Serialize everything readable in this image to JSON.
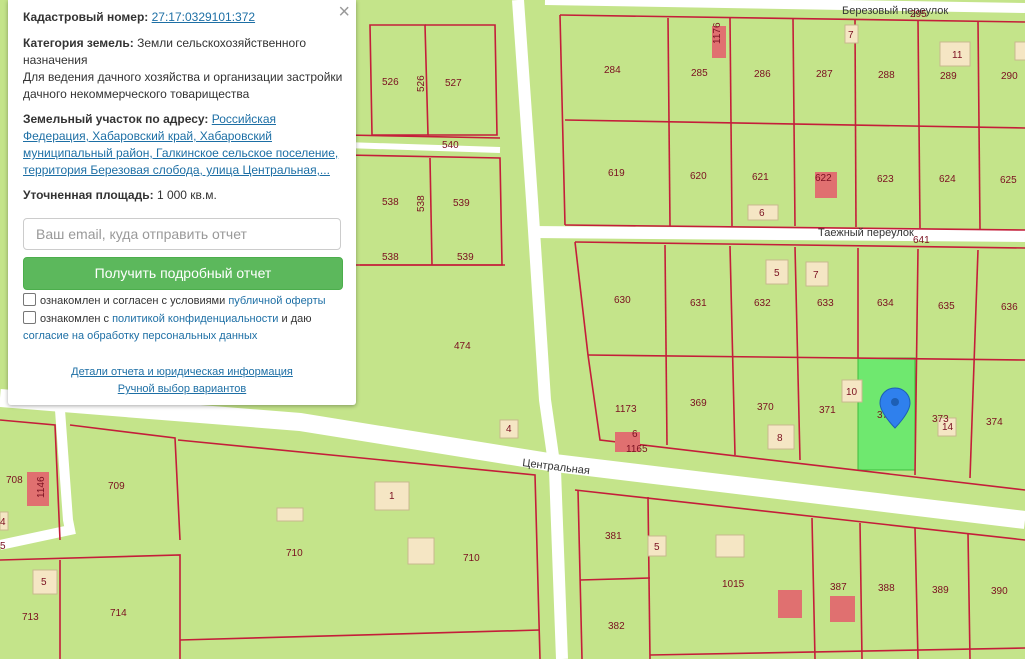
{
  "panel": {
    "close_label": "×",
    "cadastral_label": "Кадастровый номер:",
    "cadastral_value": "27:17:0329101:372",
    "category_label": "Категория земель:",
    "category_value": "Земли сельскохозяйственного",
    "category_value_2": "назначения",
    "usage_line1": "Для ведения дачного хозяйства и организации застройки",
    "usage_line2": "дачного некоммерческого товарищества",
    "address_label": "Земельный участок по адресу:",
    "address_l1": "Российская",
    "address_l2": "Федерация, Хабаровский край, Хабаровский",
    "address_l3": "муниципальный район, Галкинское сельское поселение,",
    "address_l4": "территория Березовая слобода, улица Центральная,...",
    "area_label": "Уточненная площадь:",
    "area_value": "1 000 кв.м.",
    "email_placeholder": "Ваш email, куда отправить отчет",
    "submit_label": "Получить подробный отчет",
    "consent1_text": "ознакомлен и согласен с условиями",
    "consent1_link": "публичной оферты",
    "consent2_text": "ознакомлен с",
    "consent2_link": "политикой конфиденциальности",
    "consent2_text2": "и даю",
    "consent2_link2": "согласие на обработку персональных данных",
    "details_link": "Детали отчета и юридическая информация",
    "manual_link": "Ручной выбор вариантов"
  },
  "map": {
    "colors": {
      "land": "#c4e48a",
      "boundary": "#c41e3a",
      "road": "#ffffff",
      "selected": "#6fe86f",
      "marker": "#2f80ed",
      "house": "#f5e6c4",
      "building": "#e07070"
    },
    "street_labels": {
      "berezovy": "Березовый переулок",
      "taezhny": "Таежный переулок",
      "centralnaya": "Центральная"
    },
    "parcel_labels": [
      "295",
      "1176",
      "284",
      "285",
      "286",
      "287",
      "288",
      "289",
      "290",
      "7",
      "11",
      "526",
      "526",
      "527",
      "540",
      "619",
      "620",
      "621",
      "622",
      "623",
      "624",
      "625",
      "6",
      "538",
      "538",
      "539",
      "538",
      "539",
      "641",
      "5",
      "7",
      "630",
      "631",
      "632",
      "633",
      "634",
      "635",
      "636",
      "474",
      "1173",
      "369",
      "370",
      "371",
      "10",
      "372",
      "373",
      "374",
      "14",
      "4",
      "8",
      "6",
      "1165",
      "708",
      "1146",
      "709",
      "1",
      "710",
      "710",
      "4",
      "5",
      "381",
      "5",
      "1015",
      "387",
      "388",
      "389",
      "390",
      "5",
      "713",
      "714",
      "382"
    ]
  }
}
